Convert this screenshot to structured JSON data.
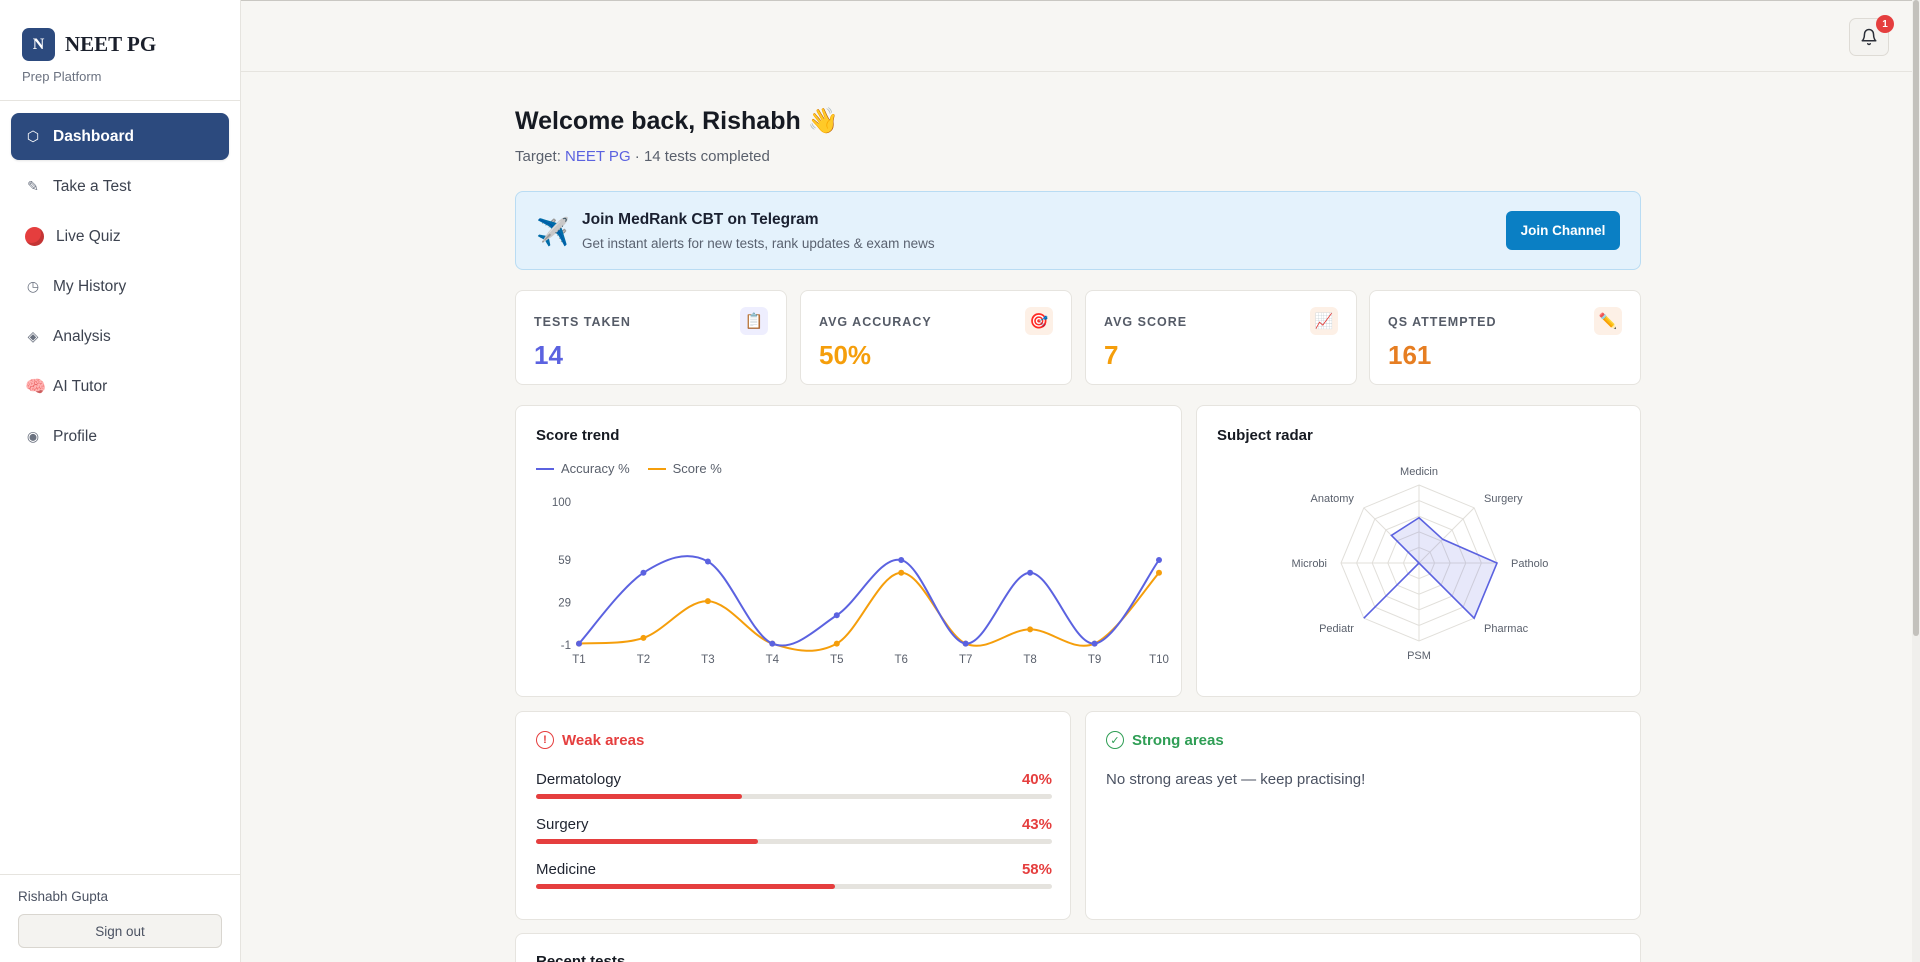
{
  "brand": {
    "logo_letter": "N",
    "name": "NEET PG",
    "subtitle": "Prep Platform"
  },
  "nav": {
    "items": [
      {
        "label": "Dashboard",
        "icon": "hexagon-icon",
        "active": true
      },
      {
        "label": "Take a Test",
        "icon": "pencil-icon"
      },
      {
        "label": "Live Quiz",
        "icon": "red-circle-icon"
      },
      {
        "label": "My History",
        "icon": "clock-icon"
      },
      {
        "label": "Analysis",
        "icon": "diamond-icon"
      },
      {
        "label": "AI Tutor",
        "icon": "brain-icon"
      },
      {
        "label": "Profile",
        "icon": "profile-circle-icon"
      }
    ]
  },
  "user": {
    "name": "Rishabh Gupta",
    "signout_label": "Sign out"
  },
  "notifications": {
    "count": "1"
  },
  "welcome": {
    "title": "Welcome back, Rishabh 👋",
    "target_prefix": "Target: ",
    "target_exam": "NEET PG",
    "target_suffix": " · 14 tests completed"
  },
  "telegram": {
    "title": "Join MedRank CBT on Telegram",
    "subtitle": "Get instant alerts for new tests, rank updates & exam news",
    "button_label": "Join Channel"
  },
  "stats": [
    {
      "label": "TESTS TAKEN",
      "value": "14",
      "color": "#5b62e0",
      "icon": "clipboard-icon",
      "icon_bg": "#eeeefe"
    },
    {
      "label": "AVG ACCURACY",
      "value": "50%",
      "color": "#f59e0b",
      "icon": "target-icon",
      "icon_bg": "#fdf0e6"
    },
    {
      "label": "AVG SCORE",
      "value": "7",
      "color": "#f59e0b",
      "icon": "chart-up-icon",
      "icon_bg": "#fdf0e6"
    },
    {
      "label": "QS ATTEMPTED",
      "value": "161",
      "color": "#e67e22",
      "icon": "pencil-icon",
      "icon_bg": "#fdf0e6"
    }
  ],
  "score_trend": {
    "title": "Score trend",
    "chart_data": {
      "type": "line",
      "x": [
        "T1",
        "T2",
        "T3",
        "T4",
        "T5",
        "T6",
        "T7",
        "T8",
        "T9",
        "T10"
      ],
      "y_ticks": [
        "100",
        "59",
        "29",
        "-1"
      ],
      "series": [
        {
          "name": "Accuracy %",
          "color": "#5b62e0",
          "values": [
            0,
            50,
            58,
            0,
            20,
            59,
            0,
            50,
            0,
            59
          ]
        },
        {
          "name": "Score %",
          "color": "#f59e0b",
          "values": [
            0,
            4,
            30,
            0,
            0,
            50,
            0,
            10,
            0,
            50
          ]
        }
      ]
    }
  },
  "subject_radar": {
    "title": "Subject radar",
    "chart_data": {
      "type": "radar",
      "categories": [
        "Medicin",
        "Surgery",
        "Patholo",
        "Pharmac",
        "PSM",
        "Pediatr",
        "Microbi",
        "Anatomy"
      ],
      "series": [
        {
          "color": "#5b62e0",
          "values": [
            58,
            43,
            100,
            100,
            0,
            100,
            0,
            50
          ]
        }
      ],
      "range": [
        0,
        100
      ]
    }
  },
  "weak_areas": {
    "title": "Weak areas",
    "items": [
      {
        "name": "Dermatology",
        "pct_label": "40%",
        "pct": 40
      },
      {
        "name": "Surgery",
        "pct_label": "43%",
        "pct": 43
      },
      {
        "name": "Medicine",
        "pct_label": "58%",
        "pct": 58
      }
    ]
  },
  "strong_areas": {
    "title": "Strong areas",
    "empty_text": "No strong areas yet — keep practising!"
  },
  "recent_tests": {
    "title": "Recent tests"
  }
}
